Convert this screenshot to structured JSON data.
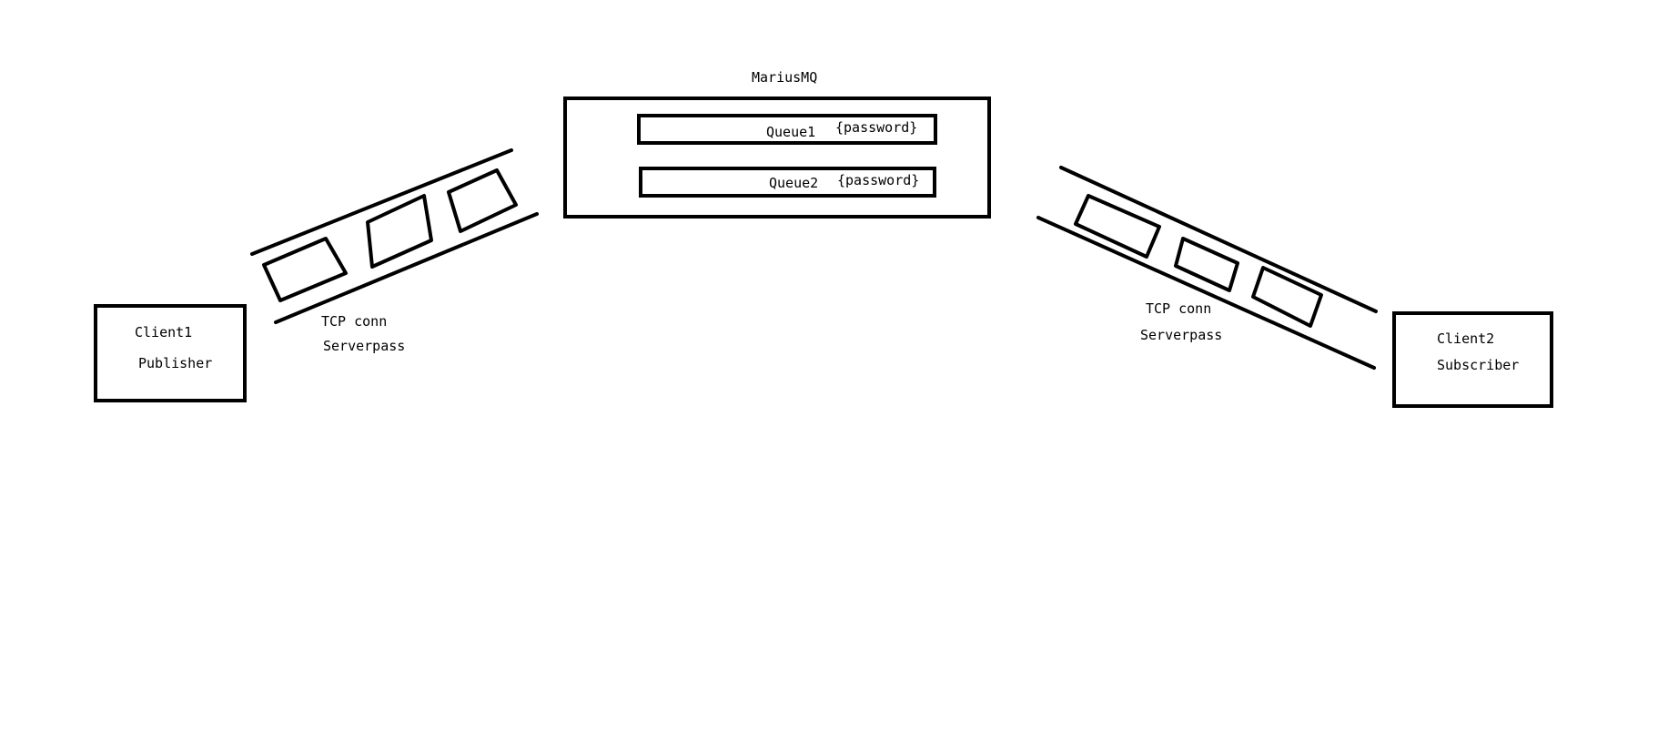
{
  "broker": {
    "title": "MariusMQ",
    "queues": [
      {
        "name": "Queue1",
        "tag": "{password}"
      },
      {
        "name": "Queue2",
        "tag": "{password}"
      }
    ]
  },
  "client_left": {
    "name": "Client1",
    "role": "Publisher"
  },
  "client_right": {
    "name": "Client2",
    "role": "Subscriber"
  },
  "connection_left": {
    "label": "TCP conn",
    "auth": "Serverpass"
  },
  "connection_right": {
    "label": "TCP conn",
    "auth": "Serverpass"
  },
  "colors": {
    "stroke": "#000000",
    "background": "#ffffff"
  }
}
